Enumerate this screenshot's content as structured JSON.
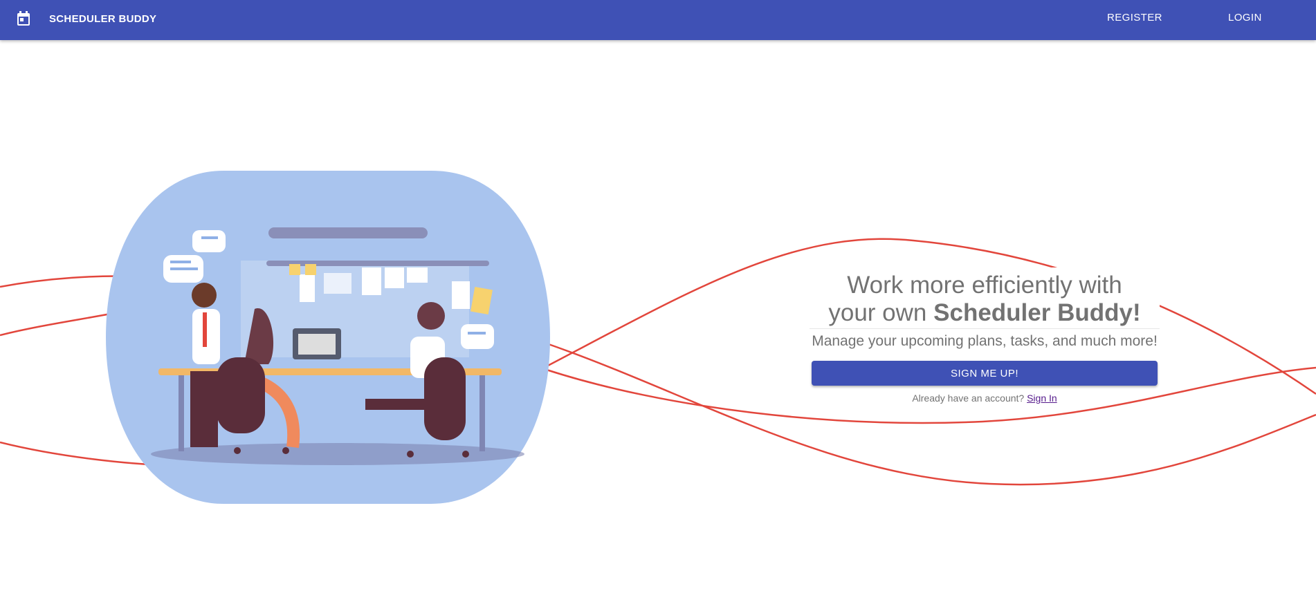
{
  "app": {
    "title": "SCHEDULER BUDDY"
  },
  "nav": {
    "register": "REGISTER",
    "login": "LOGIN"
  },
  "icons": {
    "logo": "calendar-icon"
  },
  "hero": {
    "headline_line1": "Work more efficiently with",
    "headline_line2_prefix": "your own",
    "headline_brand": "Scheduler Buddy!",
    "subheadline": "Manage your upcoming plans, tasks, and much more!",
    "cta": "SIGN ME UP!",
    "signin_prompt": "Already have an account?",
    "signin_link": "Sign In"
  },
  "colors": {
    "primary": "#3f51b5",
    "accent_lines": "#e2463c",
    "illustration_bg": "#a9c4ee",
    "text_muted": "#727272"
  }
}
